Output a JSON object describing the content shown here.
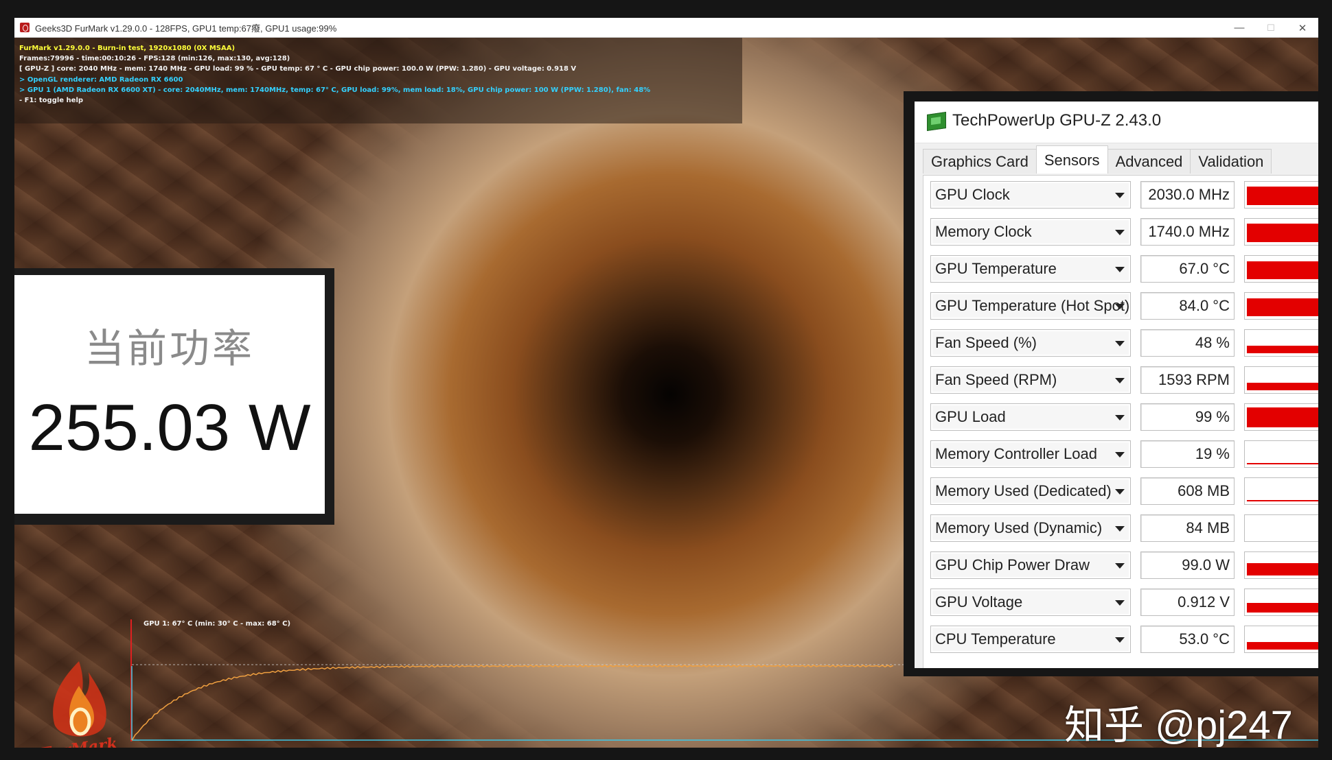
{
  "window": {
    "title": "Geeks3D FurMark v1.29.0.0 - 128FPS, GPU1 temp:67癈, GPU1 usage:99%",
    "controls": {
      "minimize": "—",
      "maximize": "☐",
      "close": "✕"
    }
  },
  "overlay": {
    "lines": [
      "FurMark v1.29.0.0 - Burn-in test, 1920x1080 (0X MSAA)",
      "Frames:79996 - time:00:10:26 - FPS:128 (min:126, max:130, avg:128)",
      "[ GPU-Z ] core: 2040 MHz - mem: 1740 MHz - GPU load: 99 % - GPU temp: 67 ° C - GPU chip power: 100.0 W (PPW: 1.280) - GPU voltage: 0.918 V",
      "> OpenGL renderer: AMD Radeon RX 6600",
      "> GPU 1 (AMD Radeon RX 6600 XT) - core: 2040MHz, mem: 1740MHz, temp: 67° C, GPU load: 99%, mem load: 18%, GPU chip power: 100 W (PPW: 1.280), fan: 48%",
      "- F1: toggle help"
    ]
  },
  "power": {
    "label": "当前功率",
    "value": "255.03 W"
  },
  "graph": {
    "title": "GPU 1: 67° C (min: 30° C - max: 68° C)",
    "line_color": "#f0a040",
    "axis_color": "#3ec7e6",
    "cursor_color": "#e02020"
  },
  "logo": {
    "text": "FurMark"
  },
  "gpuz": {
    "title": "TechPowerUp GPU-Z 2.43.0",
    "tabs": [
      "Graphics Card",
      "Sensors",
      "Advanced",
      "Validation"
    ],
    "active_tab": "Sensors",
    "bar_color": "#e30000",
    "sensors": [
      {
        "name": "GPU Clock",
        "value": "2030.0 MHz",
        "level": 0.9
      },
      {
        "name": "Memory Clock",
        "value": "1740.0 MHz",
        "level": 0.9
      },
      {
        "name": "GPU Temperature",
        "value": "67.0 °C",
        "level": 0.85
      },
      {
        "name": "GPU Temperature (Hot Spot)",
        "value": "84.0 °C",
        "level": 0.85
      },
      {
        "name": "Fan Speed (%)",
        "value": "48 %",
        "level": 0.35
      },
      {
        "name": "Fan Speed (RPM)",
        "value": "1593 RPM",
        "level": 0.35
      },
      {
        "name": "GPU Load",
        "value": "99 %",
        "level": 0.95
      },
      {
        "name": "Memory Controller Load",
        "value": "19 %",
        "level": 0.08
      },
      {
        "name": "Memory Used (Dedicated)",
        "value": "608 MB",
        "level": 0.04
      },
      {
        "name": "Memory Used (Dynamic)",
        "value": "84 MB",
        "level": 0.0
      },
      {
        "name": "GPU Chip Power Draw",
        "value": "99.0 W",
        "level": 0.6
      },
      {
        "name": "GPU Voltage",
        "value": "0.912 V",
        "level": 0.45
      },
      {
        "name": "CPU Temperature",
        "value": "53.0 °C",
        "level": 0.35
      }
    ]
  },
  "watermark": "知乎 @pj247"
}
